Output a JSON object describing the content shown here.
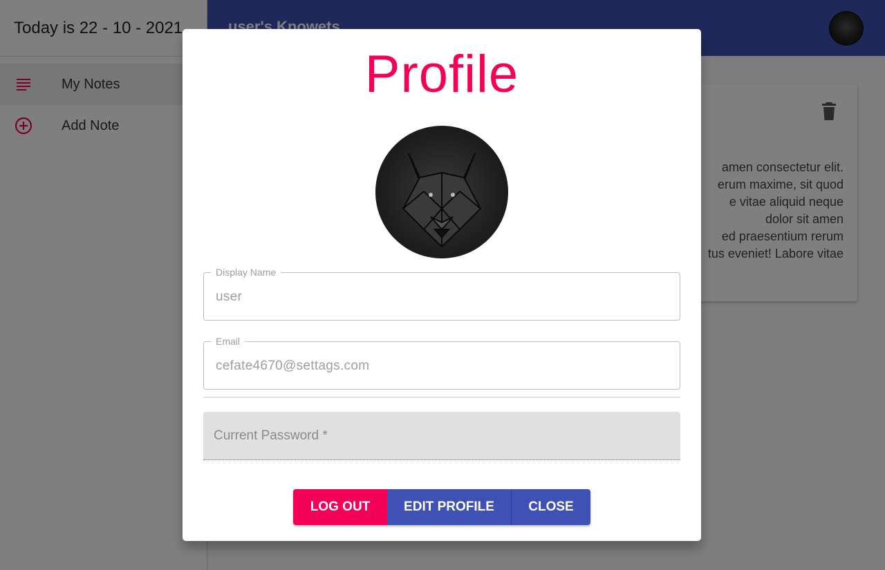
{
  "sidebar": {
    "date_text": "Today is 22 - 10 - 2021",
    "items": [
      {
        "label": "My Notes",
        "icon": "notes-list-icon"
      },
      {
        "label": "Add Note",
        "icon": "add-circle-icon"
      }
    ]
  },
  "appbar": {
    "title": "user's Knowets"
  },
  "note_card": {
    "text": "amen consectetur elit.\nerum maxime, sit quod\ne vitae aliquid neque\ndolor sit amen\ned praesentium rerum\ntus eveniet! Labore vitae"
  },
  "dialog": {
    "title": "Profile",
    "display_name_label": "Display Name",
    "display_name_value": "user",
    "email_label": "Email",
    "email_value": "cefate4670@settags.com",
    "password_placeholder": "Current Password *",
    "buttons": {
      "logout": "Log Out",
      "edit": "Edit Profile",
      "close": "Close"
    }
  },
  "colors": {
    "primary": "#3f51b5",
    "accent": "#f50057"
  }
}
